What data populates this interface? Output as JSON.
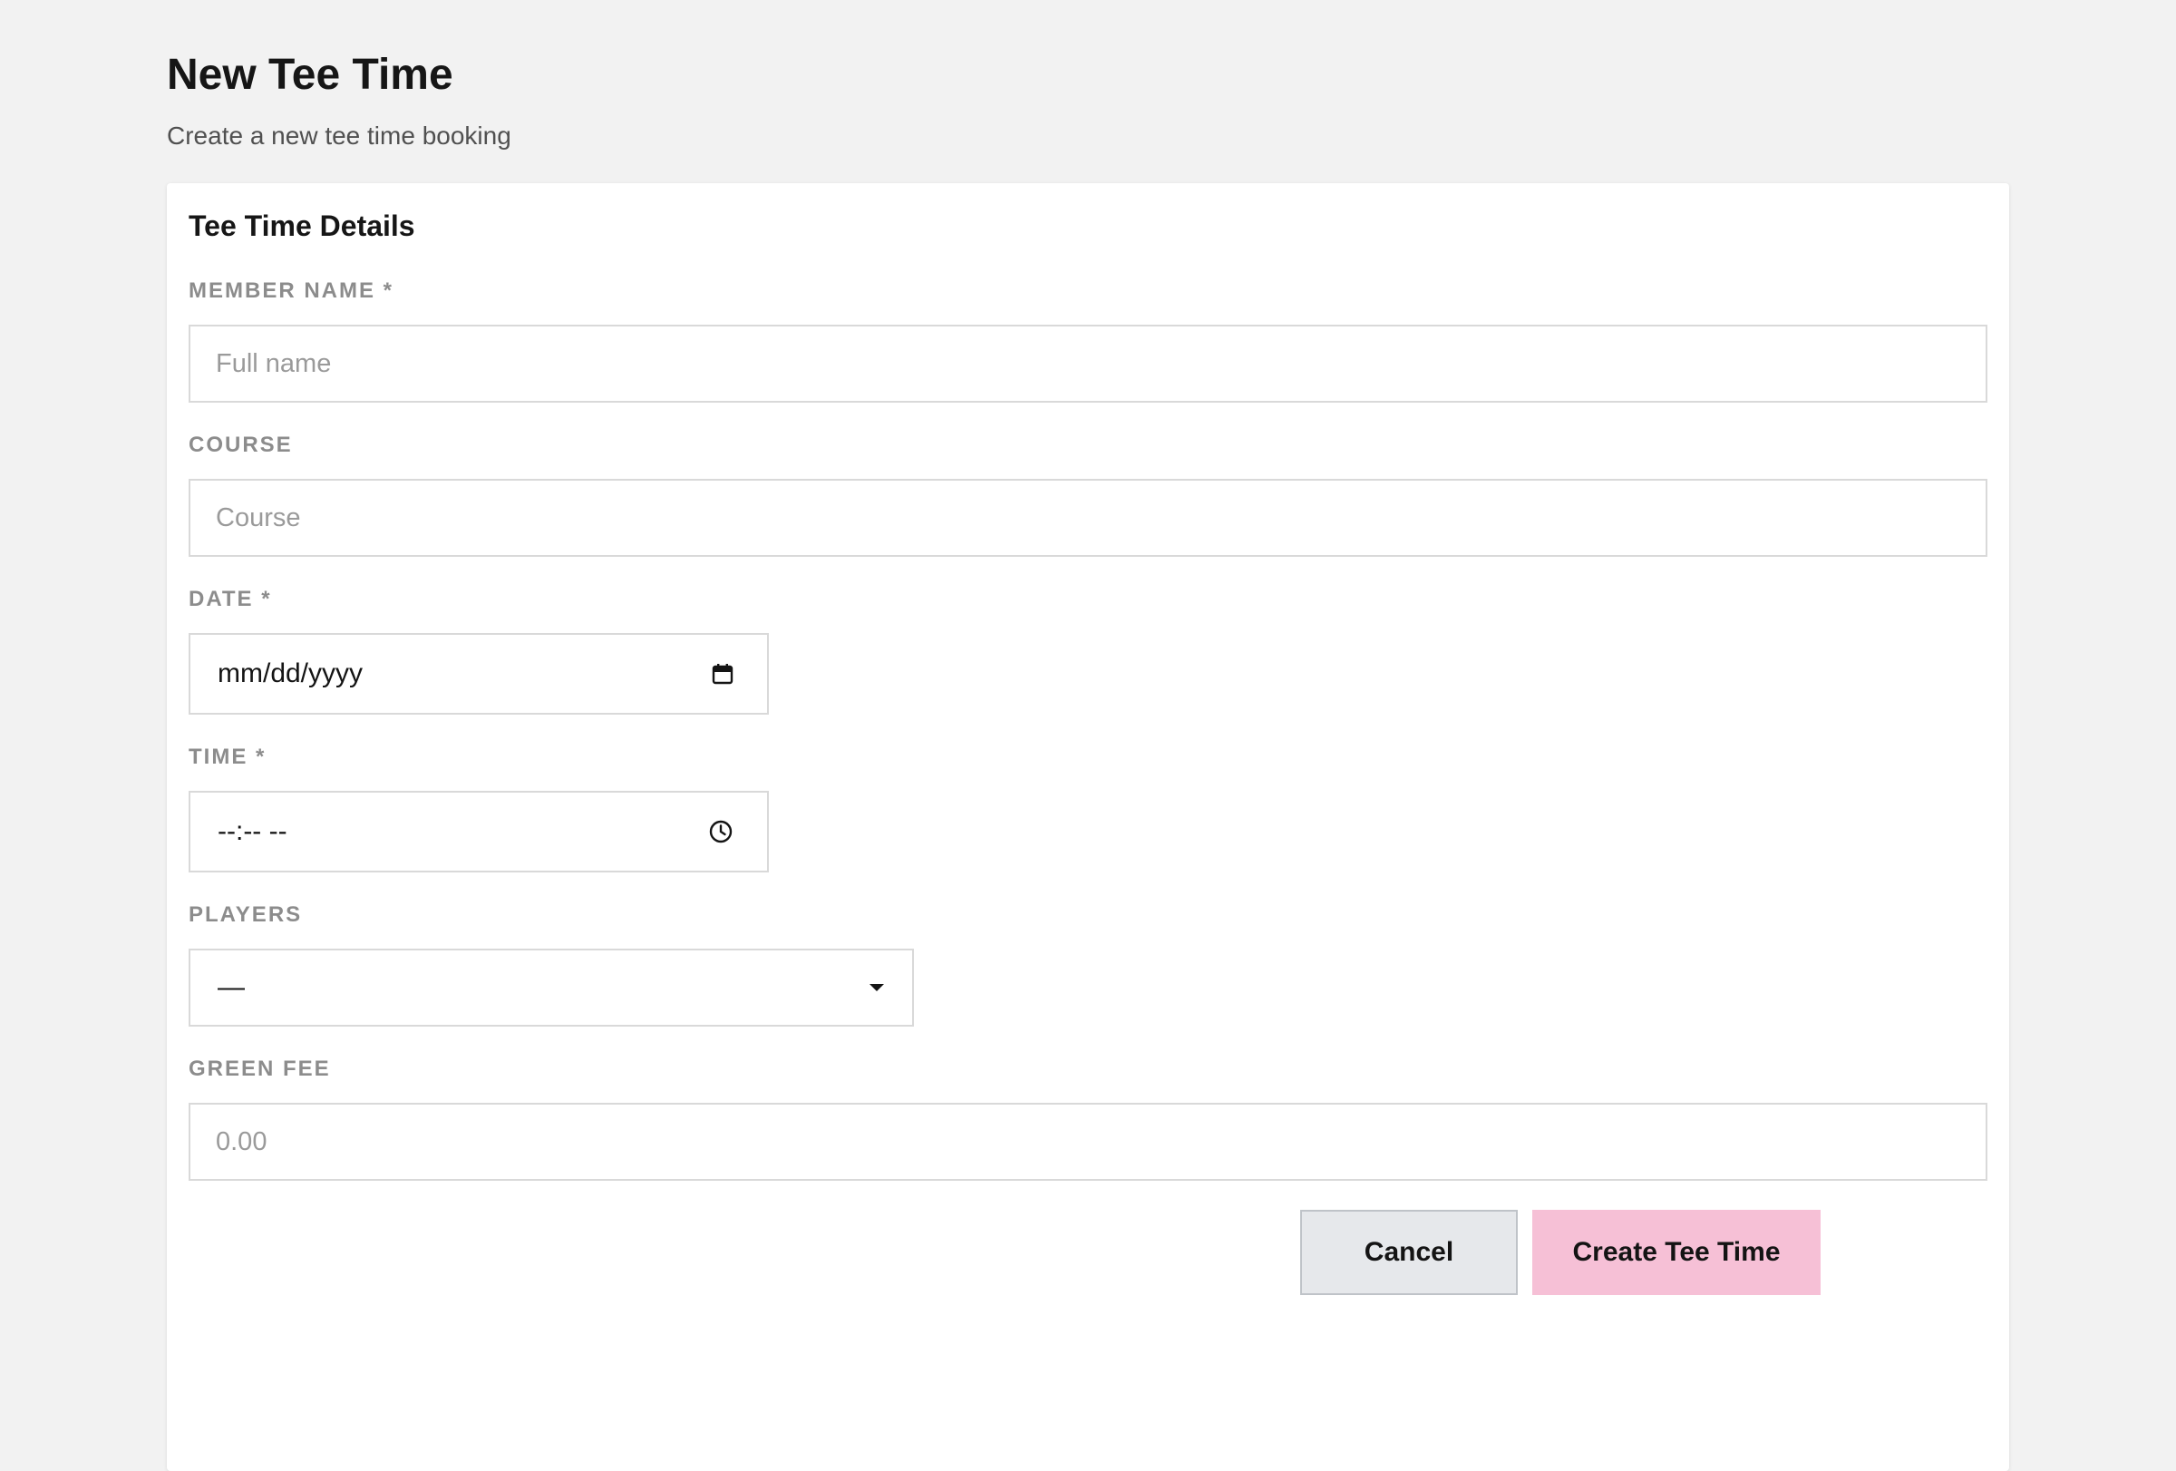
{
  "page": {
    "title": "New Tee Time",
    "subtitle": "Create a new tee time booking"
  },
  "card": {
    "title": "Tee Time Details"
  },
  "fields": {
    "member_name": {
      "label": "MEMBER NAME *",
      "placeholder": "Full name",
      "value": ""
    },
    "course": {
      "label": "COURSE",
      "placeholder": "Course",
      "value": ""
    },
    "date": {
      "label": "DATE *",
      "display": "mm/dd/yyyy",
      "icon": "calendar-icon"
    },
    "time": {
      "label": "TIME *",
      "display": "--:-- --",
      "icon": "clock-icon"
    },
    "players": {
      "label": "PLAYERS",
      "selected": "—",
      "icon": "caret-down-icon"
    },
    "green_fee": {
      "label": "GREEN FEE",
      "placeholder": "0.00",
      "value": ""
    }
  },
  "actions": {
    "cancel_label": "Cancel",
    "create_label": "Create Tee Time"
  },
  "colors": {
    "page_background": "#f2f2f2",
    "card_background": "#ffffff",
    "label_color": "#8c8c8c",
    "input_border": "#d9d9d9",
    "cancel_background": "#e6e8eb",
    "primary_button": "#f6c0d6"
  }
}
